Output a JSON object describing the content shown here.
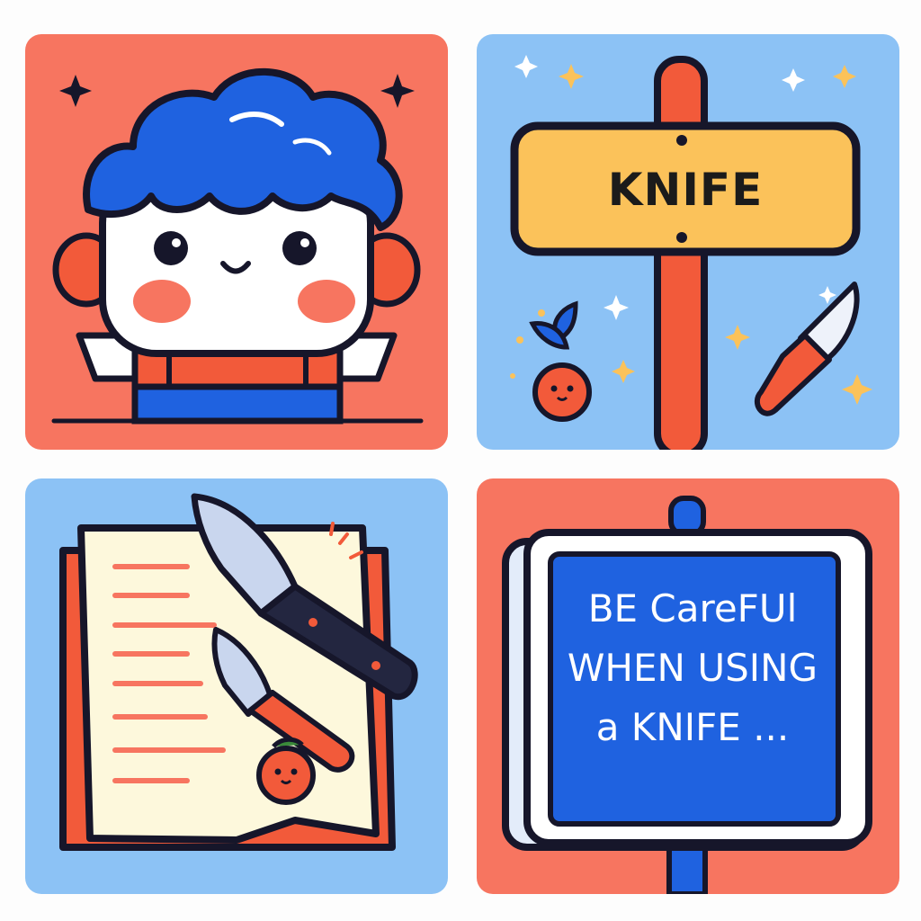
{
  "colors": {
    "coral": "#f77560",
    "sky": "#8cc2f5",
    "royal_blue": "#1f62e0",
    "sign_yellow": "#fbc25a",
    "outline": "#16162a"
  },
  "panel_boy": {
    "icons": [
      "sparkle-icon",
      "boy-character"
    ]
  },
  "panel_signpost": {
    "sign_word": "KNIFE",
    "icons": [
      "signpost",
      "knife-icon",
      "fruit-character-icon",
      "sparkle-icon"
    ]
  },
  "panel_book": {
    "icons": [
      "open-book",
      "knife-icon",
      "fruit-character-icon"
    ]
  },
  "panel_notice": {
    "lines": [
      "BE CareFUl",
      "WHEN USING",
      "a KNIFE ..."
    ]
  }
}
